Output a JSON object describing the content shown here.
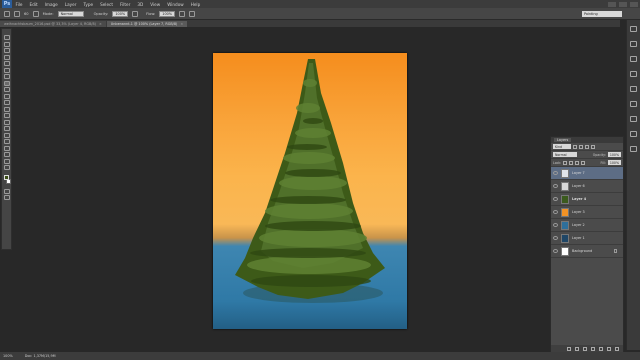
{
  "app": {
    "logo": "Ps"
  },
  "menu": [
    "File",
    "Edit",
    "Image",
    "Layer",
    "Type",
    "Select",
    "Filter",
    "3D",
    "View",
    "Window",
    "Help"
  ],
  "options": {
    "size": "60",
    "mode_label": "Mode:",
    "mode_value": "Normal",
    "opacity_label": "Opacity:",
    "opacity_value": "100%",
    "flow_label": "Flow:",
    "flow_value": "100%",
    "workspace": "Painting"
  },
  "tabs": [
    {
      "label": "weihnachtsbaum_2016.psd @ 33,3% (Layer 4, RGB/8)",
      "active": false
    },
    {
      "label": "Unbenannt-1 @ 100% (Layer 7, RGB/8)",
      "active": true
    }
  ],
  "layers_panel": {
    "title": "Layers",
    "kind": "Kind",
    "blend": "Normal",
    "opacity_label": "Opacity:",
    "opacity_value": "100%",
    "lock_label": "Lock:",
    "fill_label": "Fill:",
    "fill_value": "100%",
    "layers": [
      {
        "name": "Layer 7",
        "thumb": "#e0e4ea",
        "active": true,
        "bold": false
      },
      {
        "name": "Layer 6",
        "thumb": "#d6d6d6",
        "active": false,
        "bold": false
      },
      {
        "name": "Layer 4",
        "thumb": "#3b5a1d",
        "active": false,
        "bold": true
      },
      {
        "name": "Layer 3",
        "thumb": "#f39325",
        "active": false,
        "bold": false
      },
      {
        "name": "Layer 2",
        "thumb": "#2e6f9b",
        "active": false,
        "bold": false
      },
      {
        "name": "Layer 1",
        "thumb": "#1f4666",
        "active": false,
        "bold": false
      },
      {
        "name": "Background",
        "thumb": "#ffffff",
        "active": false,
        "bold": false
      }
    ]
  },
  "status": {
    "zoom": "100%",
    "doc": "Doc: 1,37M/15,9M"
  },
  "colors": {
    "foreground": "#3b4e17",
    "background": "#ffffff"
  }
}
